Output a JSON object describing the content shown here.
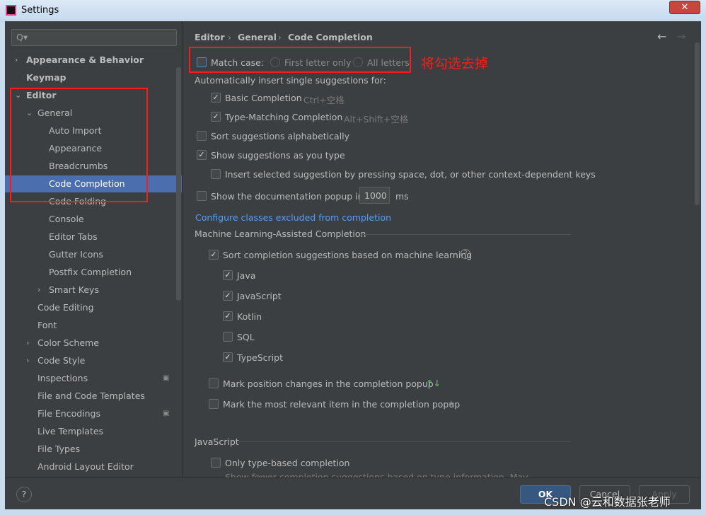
{
  "window": {
    "title": "Settings",
    "close": "✕"
  },
  "sidebar": {
    "search_placeholder": "Q▾",
    "items": [
      {
        "label": "Appearance & Behavior",
        "bold": true,
        "arrow": "›"
      },
      {
        "label": "Keymap",
        "bold": true
      },
      {
        "label": "Editor",
        "bold": true,
        "arrow": "⌄"
      },
      {
        "label": "General",
        "arrow": "⌄"
      },
      {
        "label": "Auto Import"
      },
      {
        "label": "Appearance"
      },
      {
        "label": "Breadcrumbs"
      },
      {
        "label": "Code Completion",
        "selected": true
      },
      {
        "label": "Code Folding"
      },
      {
        "label": "Console"
      },
      {
        "label": "Editor Tabs"
      },
      {
        "label": "Gutter Icons"
      },
      {
        "label": "Postfix Completion"
      },
      {
        "label": "Smart Keys",
        "arrow": "›"
      },
      {
        "label": "Code Editing"
      },
      {
        "label": "Font"
      },
      {
        "label": "Color Scheme",
        "arrow": "›"
      },
      {
        "label": "Code Style",
        "arrow": "›"
      },
      {
        "label": "Inspections",
        "badge": "▣"
      },
      {
        "label": "File and Code Templates"
      },
      {
        "label": "File Encodings",
        "badge": "▣"
      },
      {
        "label": "Live Templates"
      },
      {
        "label": "File Types"
      },
      {
        "label": "Android Layout Editor"
      }
    ]
  },
  "breadcrumb": [
    "Editor",
    "General",
    "Code Completion"
  ],
  "nav": {
    "back": "←",
    "forward": "→"
  },
  "match_case": {
    "label": "Match case:",
    "checked": false,
    "options": [
      "First letter only",
      "All letters"
    ],
    "annotation": "将勾选去掉"
  },
  "auto_insert": {
    "label": "Automatically insert single suggestions for:",
    "basic": "Basic Completion",
    "basic_key": "Ctrl+空格",
    "type": "Type-Matching Completion",
    "type_key": "Alt+Shift+空格"
  },
  "options": {
    "sort_alpha": "Sort suggestions alphabetically",
    "show_as_type": "Show suggestions as you type",
    "insert_space": "Insert selected suggestion by pressing space, dot, or other context-dependent keys",
    "doc_popup": "Show the documentation popup in",
    "doc_ms": "1000",
    "ms": "ms",
    "configure_link": "Configure classes excluded from completion"
  },
  "ml": {
    "title": "Machine Learning-Assisted Completion",
    "sort": "Sort completion suggestions based on machine learning",
    "help": "?",
    "langs": [
      {
        "label": "Java",
        "checked": true
      },
      {
        "label": "JavaScript",
        "checked": true
      },
      {
        "label": "Kotlin",
        "checked": true
      },
      {
        "label": "SQL",
        "checked": false
      },
      {
        "label": "TypeScript",
        "checked": true
      }
    ],
    "mark_pos": "Mark position changes in the completion popup",
    "mark_pos_icon": "↑↓",
    "mark_rel": "Mark the most relevant item in the completion popup",
    "mark_rel_icon": "★"
  },
  "js": {
    "title": "JavaScript",
    "only_type": "Only type-based completion",
    "desc": "Show fewer completion suggestions based on type information. May"
  },
  "buttons": {
    "help": "?",
    "ok": "OK",
    "cancel": "Cancel",
    "apply": "Apply"
  },
  "watermark": "CSDN @云和数据张老师",
  "colors": {
    "selection": "#4b6eaf",
    "annotation": "#ff1a1a",
    "link": "#589df6"
  }
}
